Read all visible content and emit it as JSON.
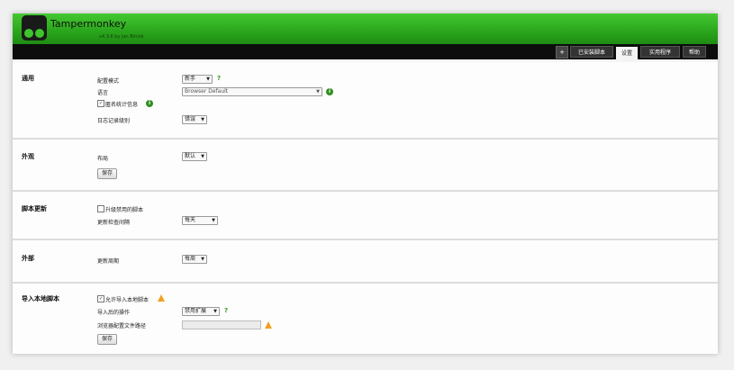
{
  "header": {
    "title": "Tampermonkey",
    "version": "v4.3.6 by Jan Biniok"
  },
  "tabs": {
    "icon": "+",
    "installed": "已安装脚本",
    "settings": "设置",
    "utilities": "实用程序",
    "help": "帮助"
  },
  "general": {
    "title": "通用",
    "config_mode_label": "配置模式",
    "config_mode_value": "新手",
    "language_label": "语言",
    "language_value": "Browser Default",
    "anon_stats_label": "匿名统计信息",
    "log_level_label": "日志记录级别",
    "log_level_value": "错误"
  },
  "appearance": {
    "title": "外观",
    "layout_label": "布局",
    "layout_value": "默认",
    "save_label": "保存"
  },
  "script_update": {
    "title": "脚本更新",
    "update_disabled_label": "升级禁用的脚本",
    "check_interval_label": "更新检查间隔",
    "check_interval_value": "每天"
  },
  "external": {
    "title": "外部",
    "update_period_label": "更新周期",
    "update_period_value": "每周"
  },
  "import_local": {
    "title": "导入本地脚本",
    "allow_import_label": "允许导入本地脚本",
    "after_import_label": "导入后的操作",
    "after_import_value": "禁用扩展",
    "browser_profile_label": "浏览器配置文件路径",
    "browser_profile_value": "",
    "save_label": "保存"
  },
  "glyphs": {
    "arrow": "▼",
    "help": "?",
    "info": "i",
    "check": "✓"
  },
  "colors": {
    "brand_green": "#2aa51b",
    "tabbar": "#0d0d0d",
    "warning": "#f0a020"
  }
}
